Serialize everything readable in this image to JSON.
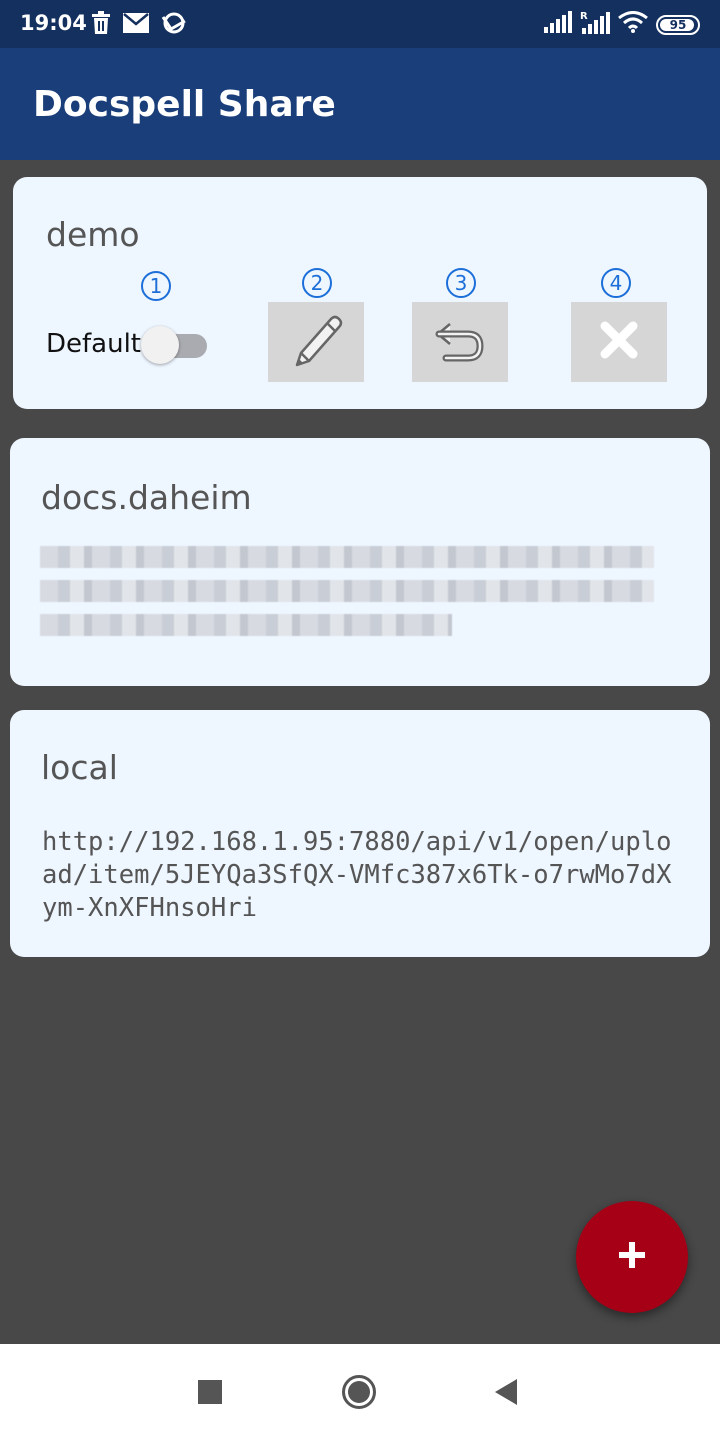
{
  "status_bar": {
    "time": "19:04",
    "battery": "95",
    "icons": [
      "trash-icon",
      "mail-icon",
      "sync-icon",
      "signal-icon",
      "roaming-signal-icon",
      "wifi-icon",
      "battery-icon"
    ]
  },
  "app_bar": {
    "title": "Docspell Share"
  },
  "cards": [
    {
      "title": "demo",
      "default_label": "Default",
      "default_enabled": false,
      "badges": [
        "1",
        "2",
        "3",
        "4"
      ],
      "actions": [
        "pencil-icon",
        "undo-icon",
        "close-icon"
      ]
    },
    {
      "title": "docs.daheim"
    },
    {
      "title": "local",
      "url": "http://192.168.1.95:7880/api/v1/open/upload/item/5JEYQa3SfQX-VMfc387x6Tk-o7rwMo7dXym-XnXFHnsoHri"
    }
  ],
  "fab": {
    "icon": "plus-icon"
  },
  "nav_bar": {
    "icons": [
      "recents-icon",
      "home-icon",
      "back-icon"
    ]
  },
  "colors": {
    "status_bar": "#13305f",
    "app_bar": "#1a3e7a",
    "background": "#484848",
    "card": "#eef6ff",
    "accent_badge": "#1c6fd8",
    "fab": "#a50016"
  }
}
